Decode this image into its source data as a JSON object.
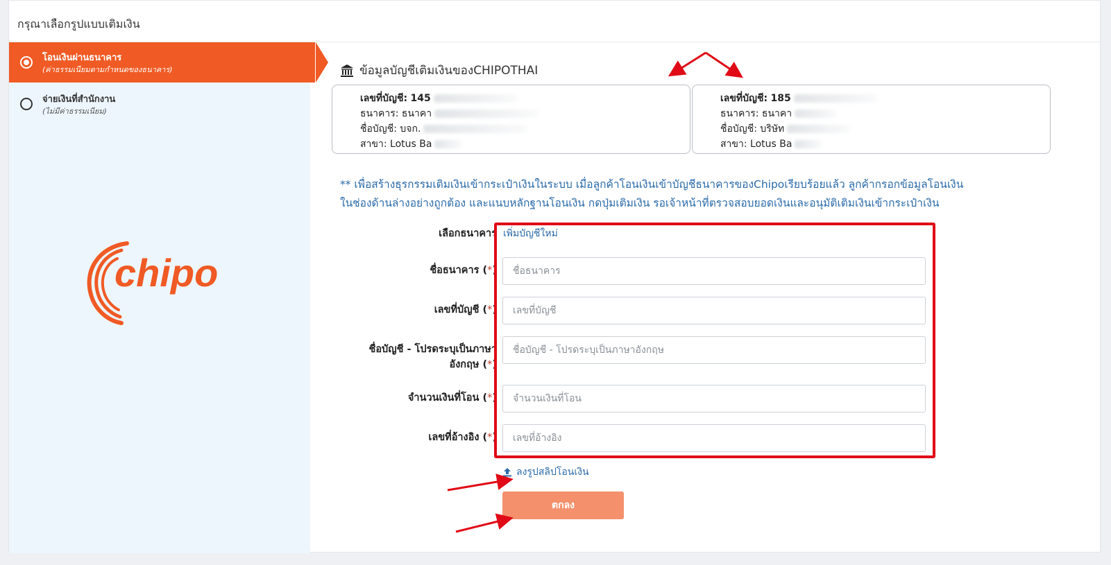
{
  "header": {
    "title": "กรุณาเลือกรูปแบบเติมเงิน"
  },
  "sidebar": {
    "items": [
      {
        "label": "โอนเงินผ่านธนาคาร",
        "sub": "(ค่าธรรมเนียมตามกำหนดของธนาคาร)",
        "selected": true
      },
      {
        "label": "จ่ายเงินที่สำนักงาน",
        "sub": "(ไม่มีค่าธรรมเนียม)",
        "selected": false
      }
    ],
    "logo_text": "chipo"
  },
  "section": {
    "title": "ข้อมูลบัญชีเติมเงินของCHIPOTHAI",
    "icon": "bank-icon"
  },
  "accounts": [
    {
      "number_label": "เลขที่บัญชี:",
      "number_value": "145",
      "bank_label": "ธนาคาร:",
      "bank_value": "ธนาคา",
      "name_label": "ชื่อบัญชี:",
      "name_value": "บจก.",
      "branch_label": "สาขา:",
      "branch_value": "Lotus Ba"
    },
    {
      "number_label": "เลขที่บัญชี:",
      "number_value": "185",
      "bank_label": "ธนาคาร:",
      "bank_value": "ธนาคา",
      "name_label": "ชื่อบัญชี:",
      "name_value": "บริษัท",
      "branch_label": "สาขา:",
      "branch_value": "Lotus Ba"
    }
  ],
  "note": {
    "line1": "** เพื่อสร้างธุรกรรมเติมเงินเข้ากระเป๋าเงินในระบบ เมื่อลูกค้าโอนเงินเข้าบัญชีธนาคารของChipoเรียบร้อยแล้ว ลูกค้ากรอกข้อมูลโอนเงิน",
    "line2": "ในช่องด้านล่างอย่างถูกต้อง และแนบหลักฐานโอนเงิน กดปุ่มเติมเงิน รอเจ้าหน้าที่ตรวจสอบยอดเงินและอนุมัติเติมเงินเข้ากระเป๋าเงิน"
  },
  "form": {
    "select_bank_label": "เลือกธนาคาร",
    "add_account_link": "เพิ่มบัญชีใหม่",
    "required_mark": "*",
    "bank_name": {
      "label": "ชื่อธนาคาร",
      "placeholder": "ชื่อธนาคาร",
      "value": ""
    },
    "account_number": {
      "label": "เลขที่บัญชี",
      "placeholder": "เลขที่บัญชี",
      "value": ""
    },
    "account_name": {
      "label_line1": "ชื่อบัญชี - โปรดระบุเป็นภาษา",
      "label_line2": "อังกฤษ",
      "placeholder": "ชื่อบัญชี - โปรดระบุเป็นภาษาอังกฤษ",
      "value": ""
    },
    "amount": {
      "label": "จำนวนเงินที่โอน",
      "placeholder": "จำนวนเงินที่โอน",
      "value": ""
    },
    "reference": {
      "label": "เลขที่อ้างอิง",
      "placeholder": "เลขที่อ้างอิง",
      "value": ""
    },
    "upload_label": "ลงรูปสลิปโอนเงิน",
    "submit_label": "ตกลง"
  },
  "colors": {
    "accent": "#f05a24",
    "annotation_red": "#e00b16",
    "link_blue": "#2a6aa8",
    "submit_bg": "#f4906c"
  }
}
